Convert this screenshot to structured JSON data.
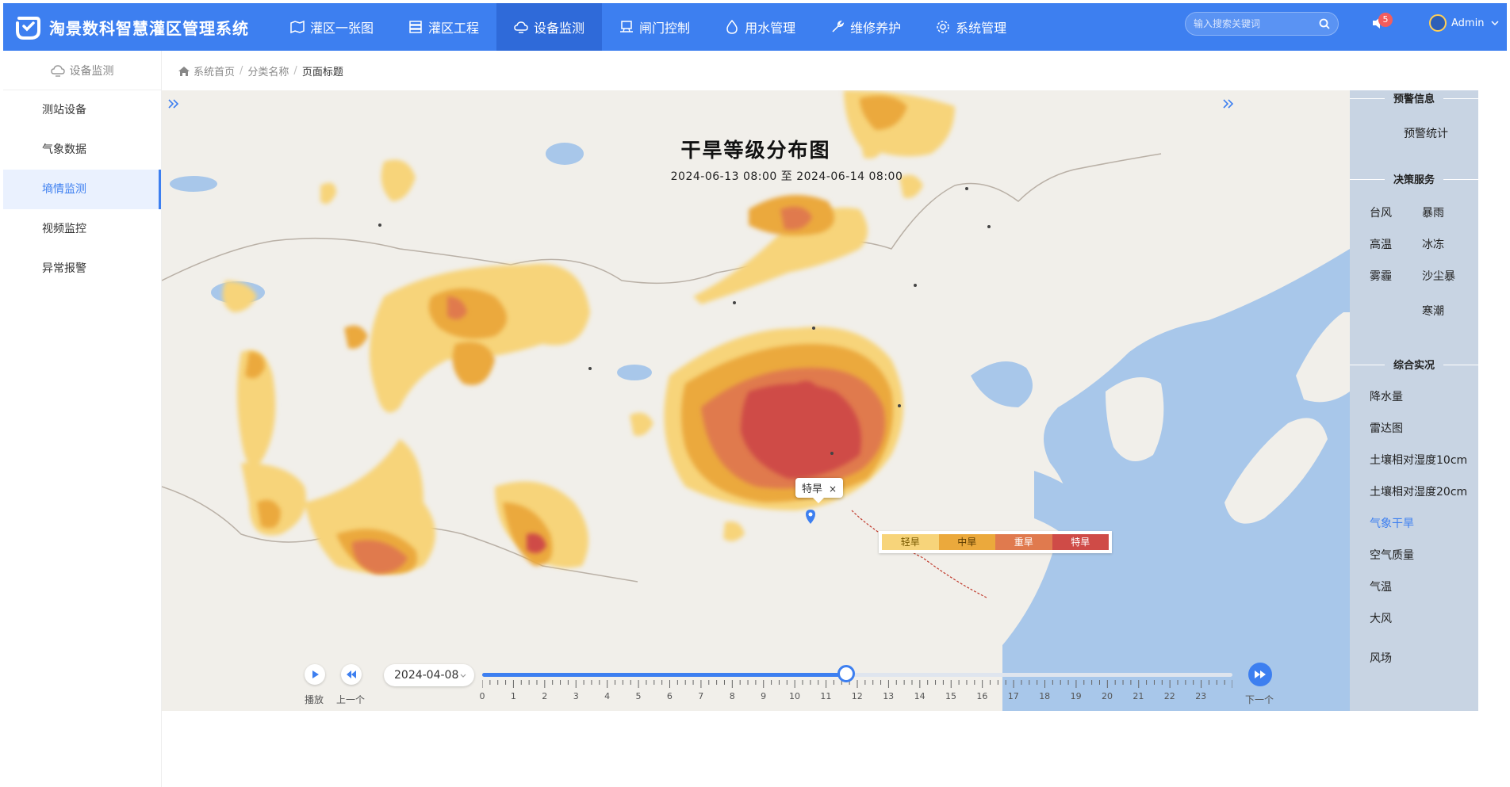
{
  "app": {
    "title": "淘景数科智慧灌区管理系统",
    "brand_color": "#3d7ff0"
  },
  "nav": [
    {
      "label": "灌区一张图",
      "icon": "map-icon"
    },
    {
      "label": "灌区工程",
      "icon": "server-icon"
    },
    {
      "label": "设备监测",
      "icon": "cloud-monitor-icon",
      "active": true
    },
    {
      "label": "闸门控制",
      "icon": "monitor-icon"
    },
    {
      "label": "用水管理",
      "icon": "water-drop-icon"
    },
    {
      "label": "维修养护",
      "icon": "wrench-icon"
    },
    {
      "label": "系统管理",
      "icon": "gear-icon"
    }
  ],
  "search": {
    "placeholder": "输入搜索关键词"
  },
  "notifications": {
    "count": "5"
  },
  "user": {
    "name": "Admin"
  },
  "sidebar": {
    "header": "设备监测",
    "items": [
      {
        "label": "测站设备"
      },
      {
        "label": "气象数据"
      },
      {
        "label": "墒情监测",
        "active": true
      },
      {
        "label": "视频监控"
      },
      {
        "label": "异常报警"
      }
    ]
  },
  "breadcrumb": {
    "home": "系统首页",
    "category": "分类名称",
    "page": "页面标题"
  },
  "map": {
    "title": "干旱等级分布图",
    "subtitle": "2024-06-13 08:00 至 2024-06-14 08:00",
    "tooltip": {
      "label": "特旱",
      "close": "×"
    },
    "legend": [
      {
        "label": "轻旱",
        "color": "#f7d47a"
      },
      {
        "label": "中旱",
        "color": "#eba93c"
      },
      {
        "label": "重旱",
        "color": "#e07a4e"
      },
      {
        "label": "特旱",
        "color": "#cf4b47"
      }
    ]
  },
  "player": {
    "play_label": "播放",
    "prev_label": "上一个",
    "next_label": "下一个",
    "date": "2024-04-08",
    "hours": [
      "0",
      "1",
      "2",
      "3",
      "4",
      "5",
      "6",
      "7",
      "8",
      "9",
      "10",
      "11",
      "12",
      "13",
      "14",
      "15",
      "16",
      "17",
      "18",
      "19",
      "20",
      "21",
      "22",
      "23"
    ],
    "progress": 0.485
  },
  "right_panel": {
    "sections": [
      {
        "title": "预警信息",
        "items": [
          "预警统计"
        ]
      },
      {
        "title": "决策服务",
        "items": [
          "台风",
          "暴雨",
          "高温",
          "冰冻",
          "雾霾",
          "沙尘暴",
          "寒潮"
        ]
      },
      {
        "title": "综合实况",
        "items": [
          "降水量",
          "雷达图",
          "土壤相对湿度10cm",
          "土壤相对湿度20cm",
          "气象干旱",
          "空气质量",
          "气温",
          "大风",
          "风场"
        ],
        "active": "气象干旱"
      }
    ]
  }
}
